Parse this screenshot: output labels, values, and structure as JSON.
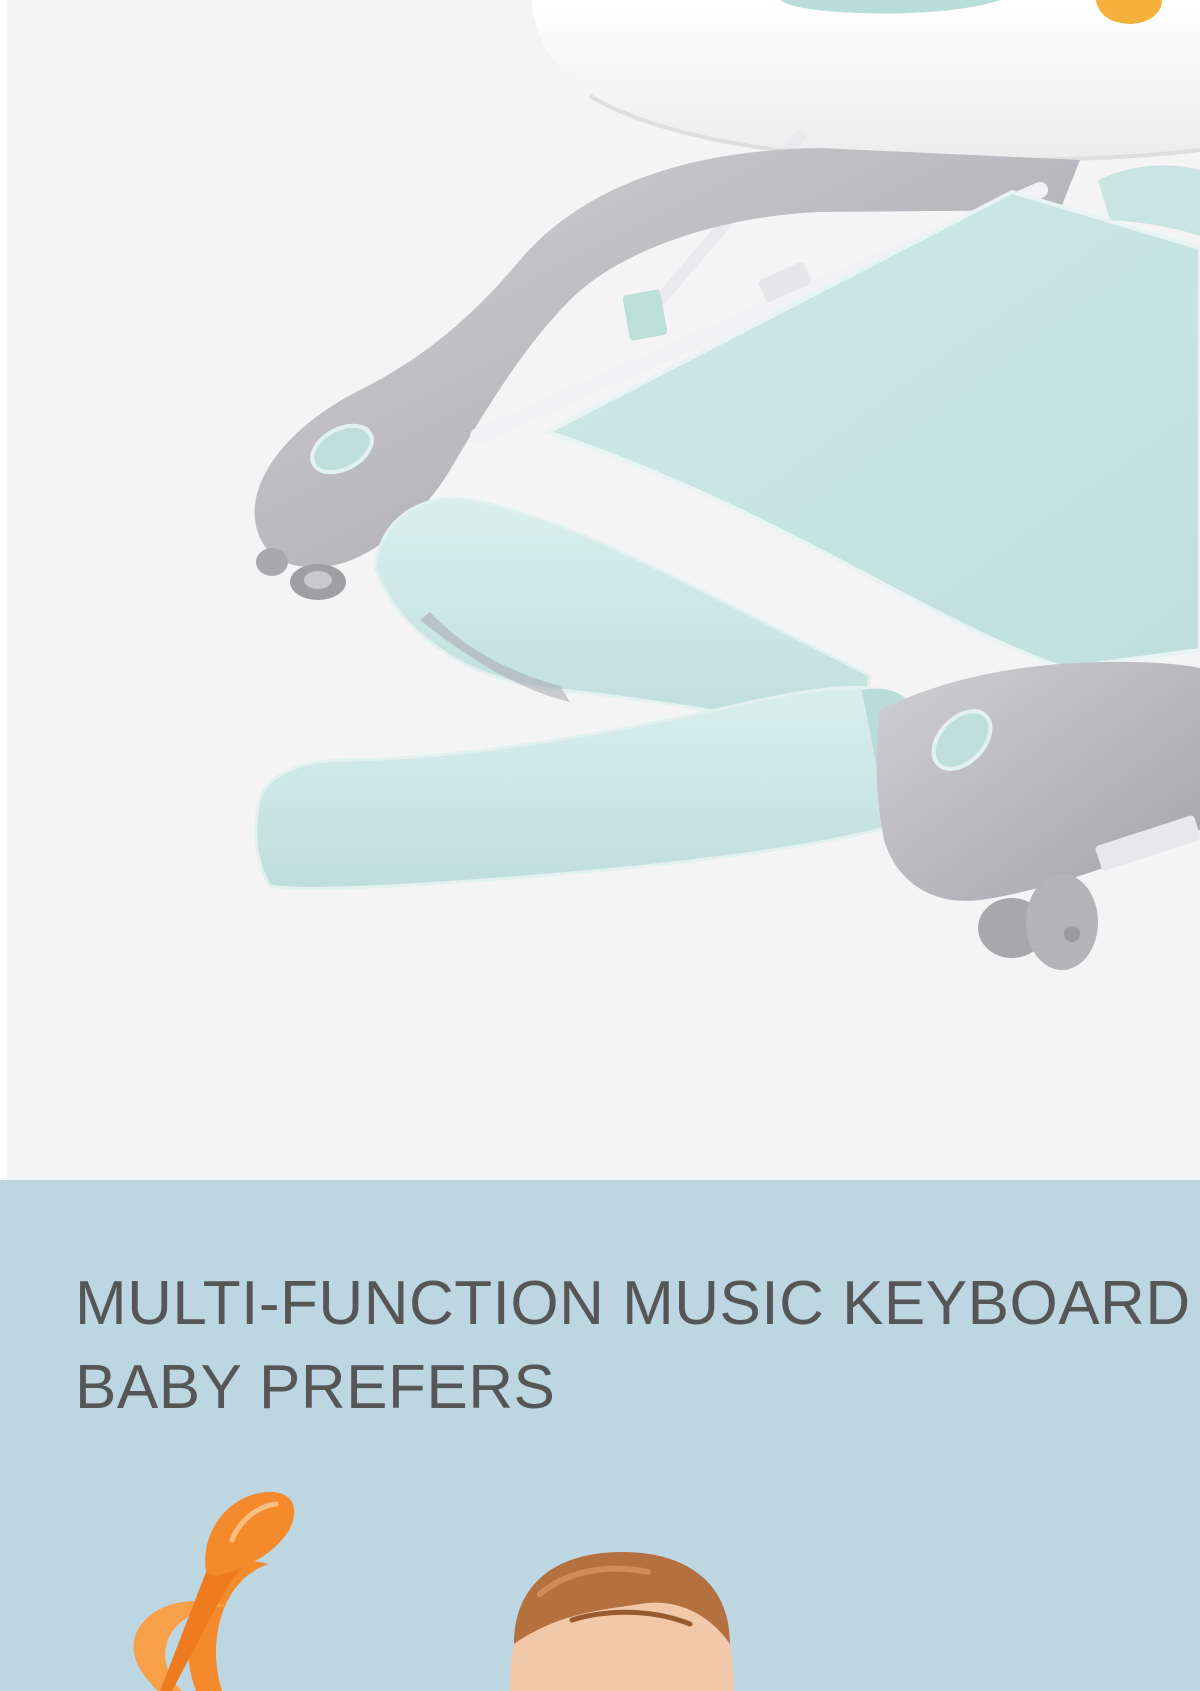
{
  "feature": {
    "title_line_1": "MULTI-FUNCTION MUSIC KEYBOARD",
    "title_line_2": "BABY PREFERS"
  },
  "colors": {
    "photo_background": "#f4f4f4",
    "page_white": "#ffffff",
    "feature_background": "#bcd7e2",
    "title_text": "#575657",
    "walker_gray": "#b7b6bb",
    "walker_mint": "#c8e5e1",
    "walker_tray_white": "#fbfbfb",
    "music_note_orange": "#f48a2c",
    "baby_hair": "#b5703f"
  },
  "images": {
    "top_photo": "baby-walker-product-photo",
    "note_icon": "music-note-icon",
    "baby": "baby-photo"
  }
}
